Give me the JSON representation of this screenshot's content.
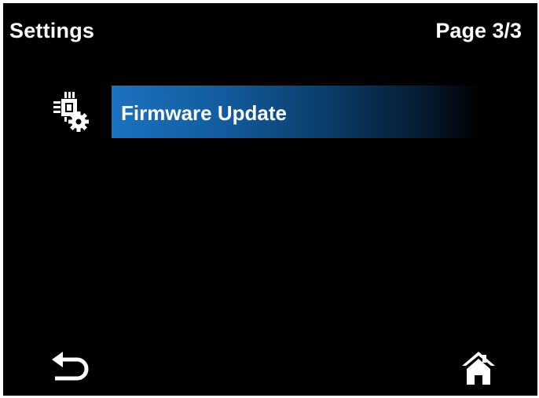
{
  "header": {
    "title": "Settings",
    "page_indicator": "Page 3/3"
  },
  "menu": {
    "items": [
      {
        "label": "Firmware Update",
        "icon": "firmware-chip-gear-icon",
        "selected": true
      }
    ]
  },
  "footer": {
    "back_icon": "back-arrow-icon",
    "home_icon": "home-icon"
  },
  "colors": {
    "background": "#000000",
    "text": "#ffffff",
    "highlight": "#1b72c0"
  }
}
